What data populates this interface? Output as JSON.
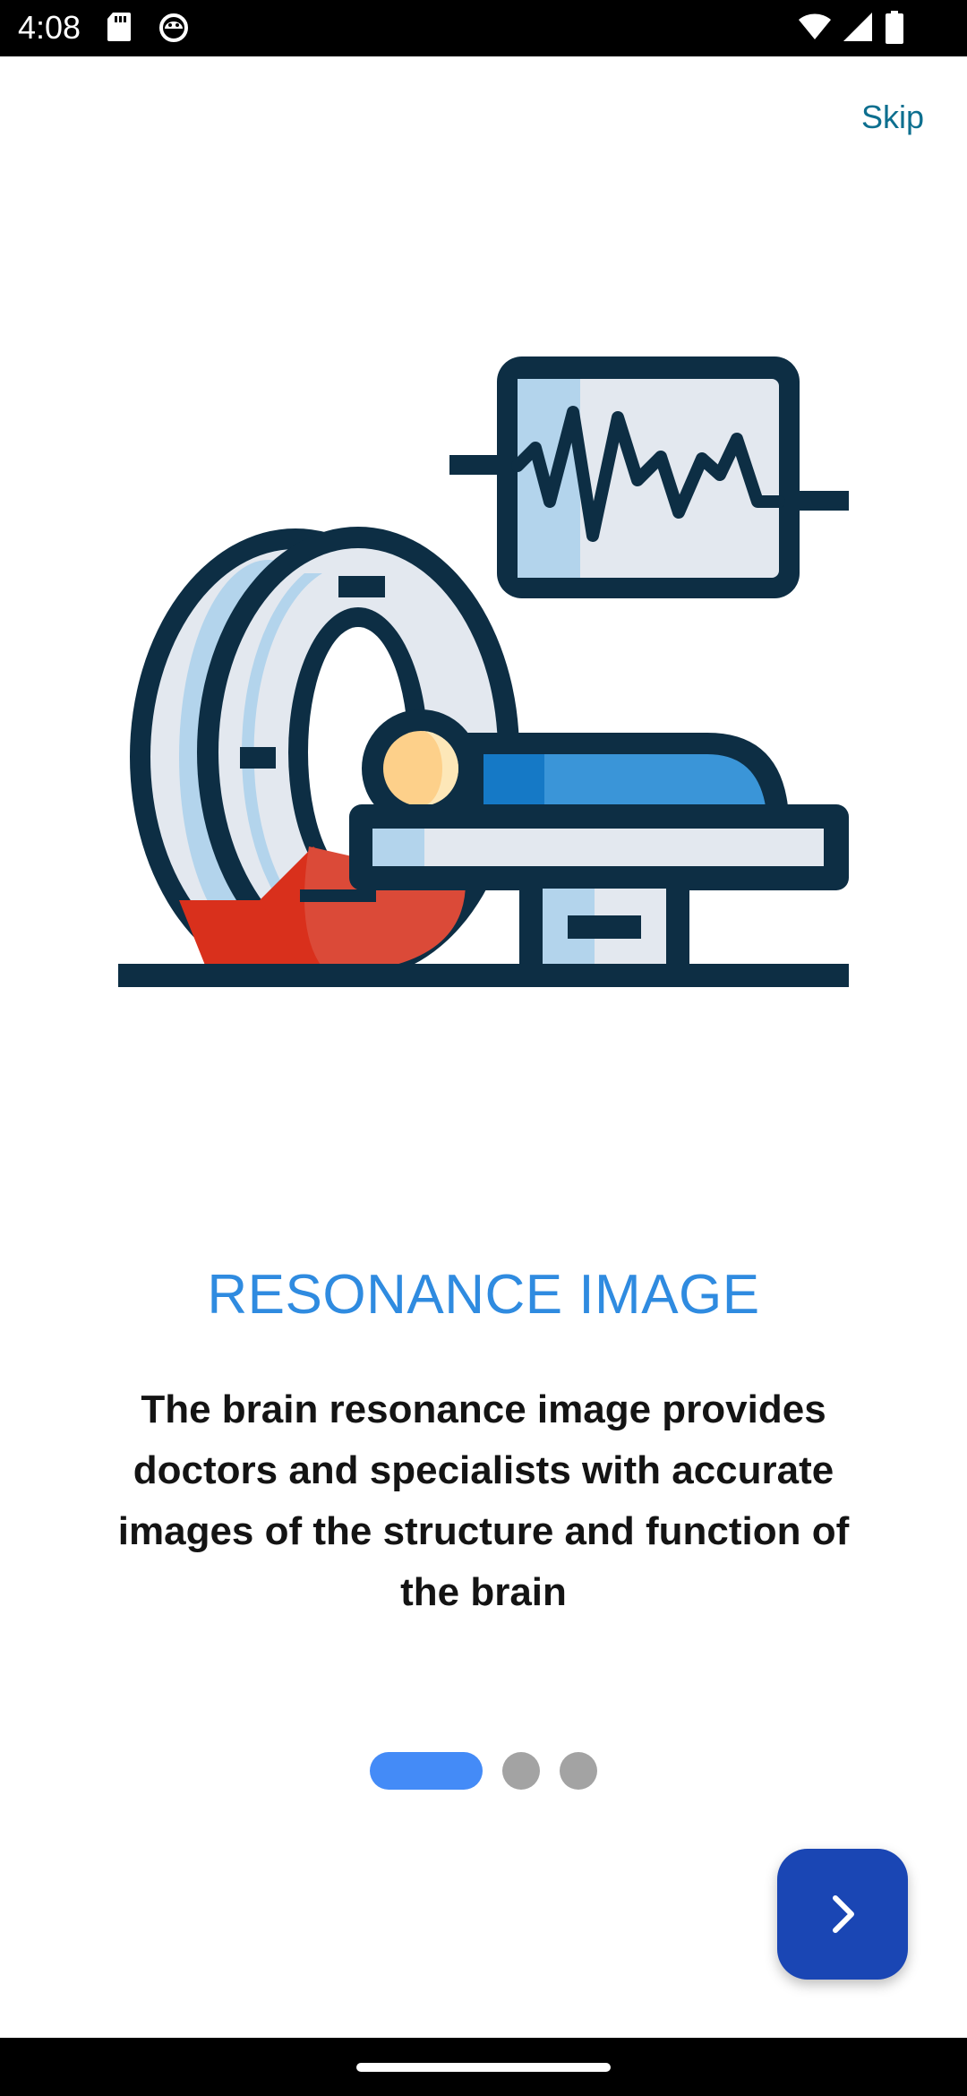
{
  "status_bar": {
    "time": "4:08",
    "icons": [
      "sd-card-icon",
      "android-debug-icon",
      "wifi-icon",
      "signal-icon",
      "battery-icon"
    ]
  },
  "header": {
    "skip_label": "Skip"
  },
  "onboarding": {
    "illustration": "mri-scanner-illustration",
    "title": "RESONANCE IMAGE",
    "description": "The brain resonance image provides doctors and specialists with accurate images of the structure and function of the brain",
    "pager": {
      "current_page": 1,
      "total_pages": 3
    },
    "next_icon": "chevron-right-icon"
  },
  "colors": {
    "accent": "#2f8be0",
    "skip": "#0d6f8f",
    "next_button": "#1a46b4",
    "pager_active": "#448bf7",
    "pager_inactive": "#a3a3a3",
    "outline": "#0d2e44"
  }
}
